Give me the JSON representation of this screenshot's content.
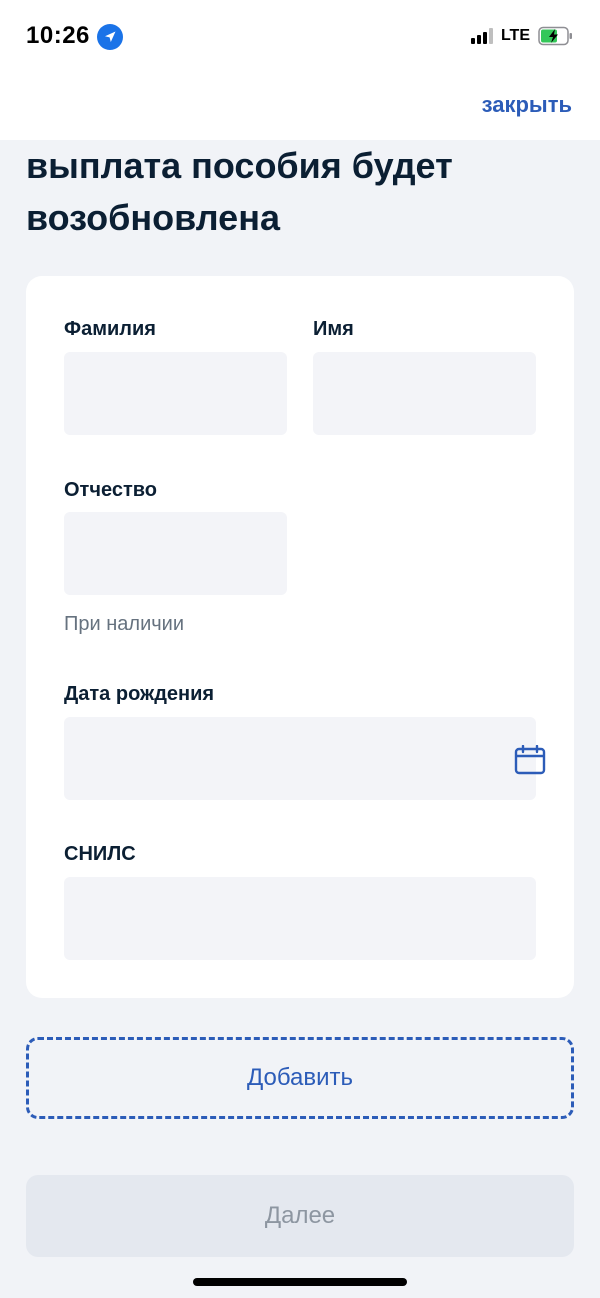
{
  "status_bar": {
    "time": "10:26",
    "network": "LTE",
    "icons": [
      "location-arrow-icon",
      "signal-icon",
      "battery-charging-icon"
    ]
  },
  "header": {
    "close_label": "закрыть"
  },
  "page": {
    "title": "выплата пособия будет возобновлена"
  },
  "form": {
    "last_name": {
      "label": "Фамилия",
      "value": ""
    },
    "first_name": {
      "label": "Имя",
      "value": ""
    },
    "middle_name": {
      "label": "Отчество",
      "value": "",
      "hint": "При наличии"
    },
    "birth_date": {
      "label": "Дата рождения",
      "value": "",
      "icon": "calendar-icon"
    },
    "snils": {
      "label": "СНИЛС",
      "value": ""
    }
  },
  "actions": {
    "add_label": "Добавить",
    "next_label": "Далее"
  },
  "colors": {
    "accent": "#2c5cb8",
    "background": "#f1f3f7",
    "card": "#ffffff",
    "input_fill": "#f3f4f8",
    "disabled_button": "#e4e8ef",
    "disabled_text": "#8d96a1"
  }
}
